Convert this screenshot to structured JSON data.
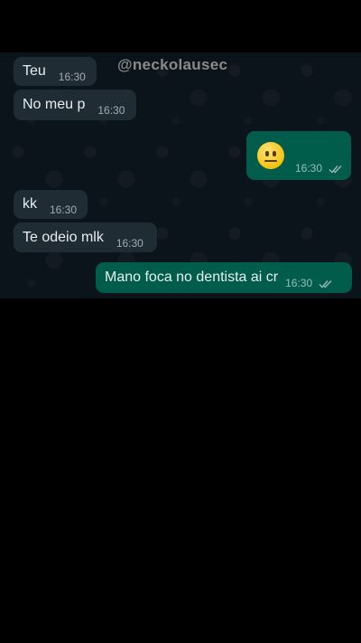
{
  "watermark": "@neckolausec",
  "messages": [
    {
      "text": "Teu",
      "time": "16:30",
      "dir": "in"
    },
    {
      "text": "No meu p",
      "time": "16:30",
      "dir": "in"
    },
    {
      "text": "",
      "emoji": "neutral-face",
      "time": "16:30",
      "dir": "out",
      "status": "read"
    },
    {
      "text": "kk",
      "time": "16:30",
      "dir": "in"
    },
    {
      "text": "Te odeio mlk",
      "time": "16:30",
      "dir": "in"
    },
    {
      "text": "Mano foca no dentista ai cr",
      "time": "16:30",
      "dir": "out",
      "status": "read"
    }
  ],
  "colors": {
    "chat_bg": "#0b141a",
    "incoming_bubble": "#1f2c34",
    "outgoing_bubble": "#005c4b",
    "text": "#e9edef"
  }
}
